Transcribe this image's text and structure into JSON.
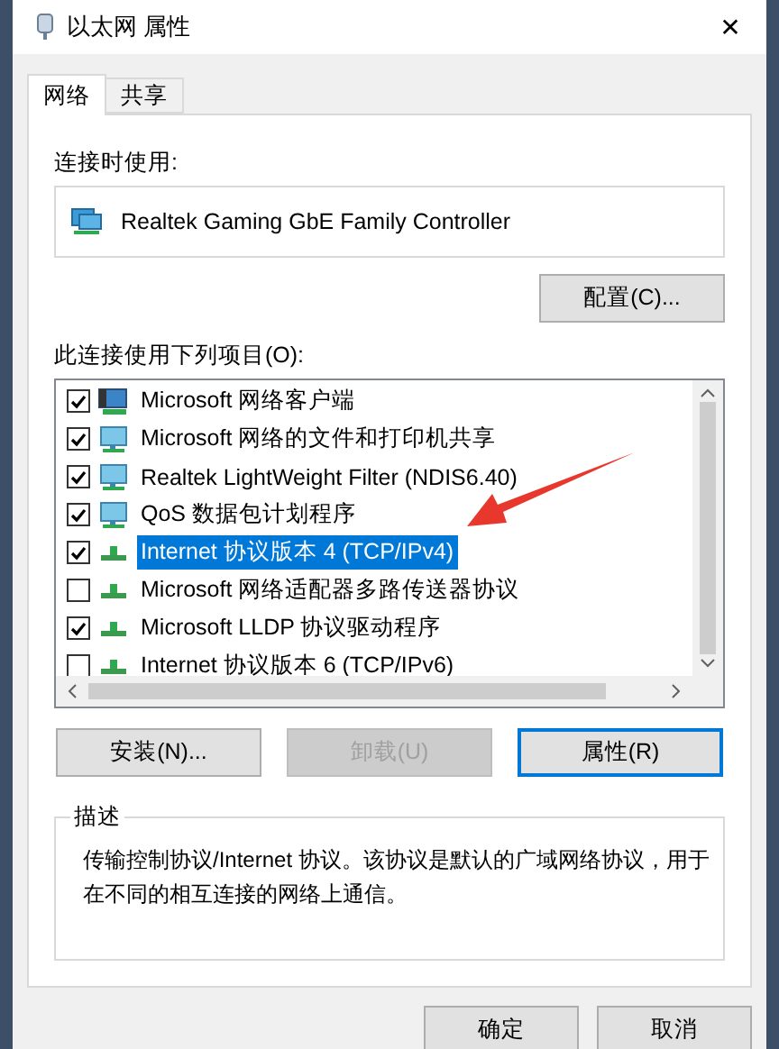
{
  "window": {
    "title": "以太网 属性",
    "close": "✕"
  },
  "tabs": [
    {
      "label": "网络",
      "selected": true
    },
    {
      "label": "共享",
      "selected": false
    }
  ],
  "connect_using": {
    "label": "连接时使用:",
    "adapter": "Realtek Gaming GbE Family Controller",
    "configure_button": "配置(C)..."
  },
  "items_label": "此连接使用下列项目(O):",
  "items": [
    {
      "kind": "client",
      "label": "Microsoft 网络客户端",
      "checked": true,
      "selected": false
    },
    {
      "kind": "service",
      "label": "Microsoft 网络的文件和打印机共享",
      "checked": true,
      "selected": false
    },
    {
      "kind": "service",
      "label": "Realtek LightWeight Filter (NDIS6.40)",
      "checked": true,
      "selected": false
    },
    {
      "kind": "service",
      "label": "QoS 数据包计划程序",
      "checked": true,
      "selected": false
    },
    {
      "kind": "protocol",
      "label": "Internet 协议版本 4 (TCP/IPv4)",
      "checked": true,
      "selected": true
    },
    {
      "kind": "protocol",
      "label": "Microsoft 网络适配器多路传送器协议",
      "checked": false,
      "selected": false
    },
    {
      "kind": "protocol",
      "label": "Microsoft LLDP 协议驱动程序",
      "checked": true,
      "selected": false
    },
    {
      "kind": "protocol",
      "label": "Internet 协议版本 6 (TCP/IPv6)",
      "checked": false,
      "selected": false
    }
  ],
  "item_buttons": [
    {
      "label": "安装(N)...",
      "disabled": false,
      "focused": false
    },
    {
      "label": "卸载(U)",
      "disabled": true,
      "focused": false
    },
    {
      "label": "属性(R)",
      "disabled": false,
      "focused": true
    }
  ],
  "description": {
    "title": "描述",
    "text": "传输控制协议/Internet 协议。该协议是默认的广域网络协议，用于在不同的相互连接的网络上通信。"
  },
  "dialog_buttons": [
    "确定",
    "取消"
  ]
}
